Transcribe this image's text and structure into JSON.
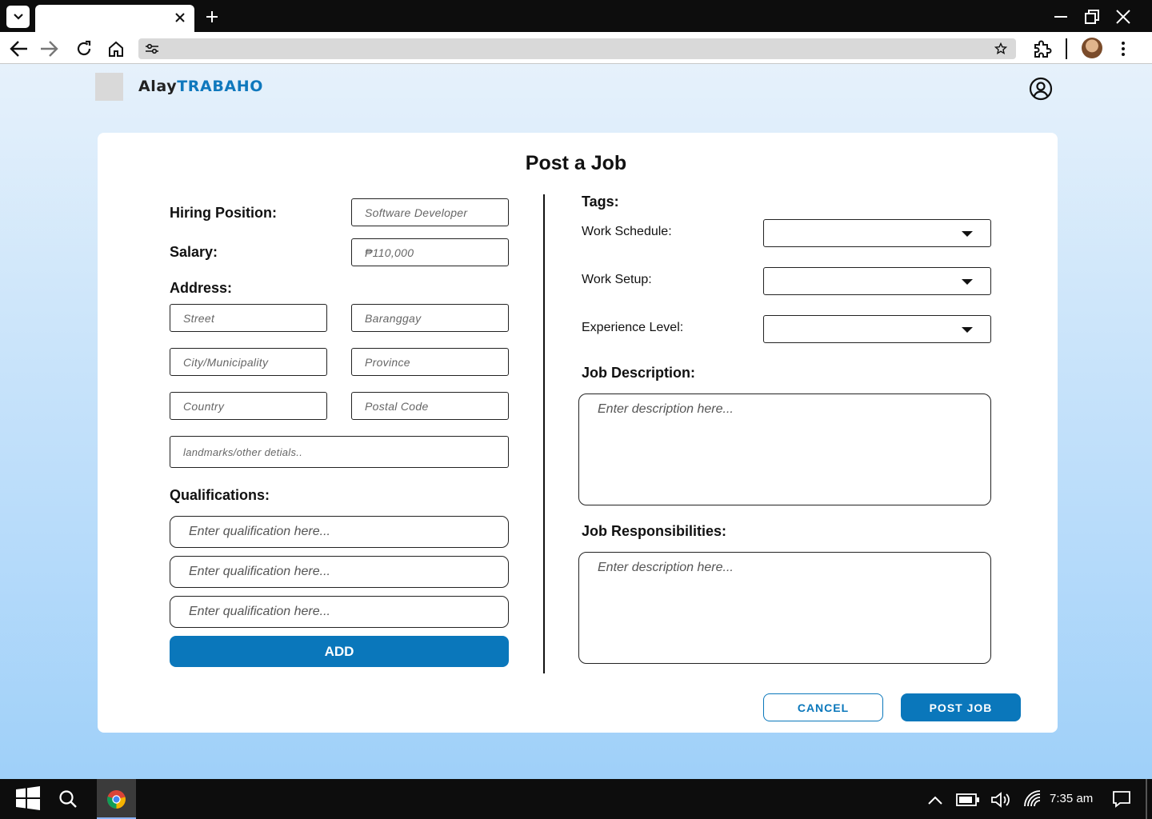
{
  "browser": {
    "tab_title": "",
    "url": ""
  },
  "app": {
    "brand_part1": "Alay",
    "brand_part2": "TRABAHO",
    "accent_color": "#0a77bb"
  },
  "form": {
    "title": "Post a Job",
    "hiring_position": {
      "label": "Hiring Position:",
      "placeholder": "Software Developer"
    },
    "salary": {
      "label": "Salary:",
      "placeholder": "₱110,000"
    },
    "address": {
      "label": "Address:",
      "street": "Street",
      "barangay": "Baranggay",
      "city": "City/Municipality",
      "province": "Province",
      "country": "Country",
      "postal": "Postal Code",
      "landmarks": "landmarks/other detials.."
    },
    "qualifications": {
      "label": "Qualifications:",
      "items": [
        "Enter qualification here...",
        "Enter qualification here...",
        "Enter qualification here..."
      ],
      "add_label": "ADD"
    },
    "tags": {
      "label": "Tags:",
      "work_schedule": {
        "label": "Work Schedule:",
        "value": ""
      },
      "work_setup": {
        "label": "Work Setup:",
        "value": ""
      },
      "experience_level": {
        "label": "Experience Level:",
        "value": ""
      }
    },
    "job_description": {
      "label": "Job Description:",
      "placeholder": "Enter description here..."
    },
    "job_responsibilities": {
      "label": "Job Responsibilities:",
      "placeholder": "Enter description here..."
    },
    "cancel_label": "CANCEL",
    "post_label": "POST JOB"
  },
  "taskbar": {
    "time": "7:35 am"
  }
}
